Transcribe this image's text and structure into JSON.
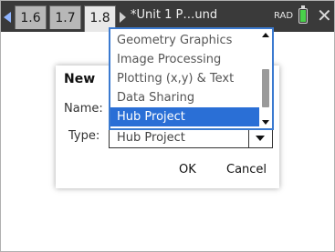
{
  "tabs": [
    {
      "label": "1.6"
    },
    {
      "label": "1.7"
    },
    {
      "label": "1.8"
    }
  ],
  "document_title": "*Unit 1 P…und",
  "angle_mode": "RAD",
  "dialog": {
    "title": "New",
    "name_label": "Name:",
    "type_label": "Type:",
    "type_value": "Hub Project",
    "ok_label": "OK",
    "cancel_label": "Cancel"
  },
  "dropdown": {
    "options": [
      {
        "label": "Geometry Graphics"
      },
      {
        "label": "Image Processing"
      },
      {
        "label": "Plotting (x,y) & Text"
      },
      {
        "label": "Data Sharing"
      },
      {
        "label": "Hub Project"
      }
    ],
    "selected": "Hub Project"
  },
  "colors": {
    "topbar": "#3a3a3a",
    "selection": "#2a6fd6",
    "battery": "#49d14a"
  }
}
